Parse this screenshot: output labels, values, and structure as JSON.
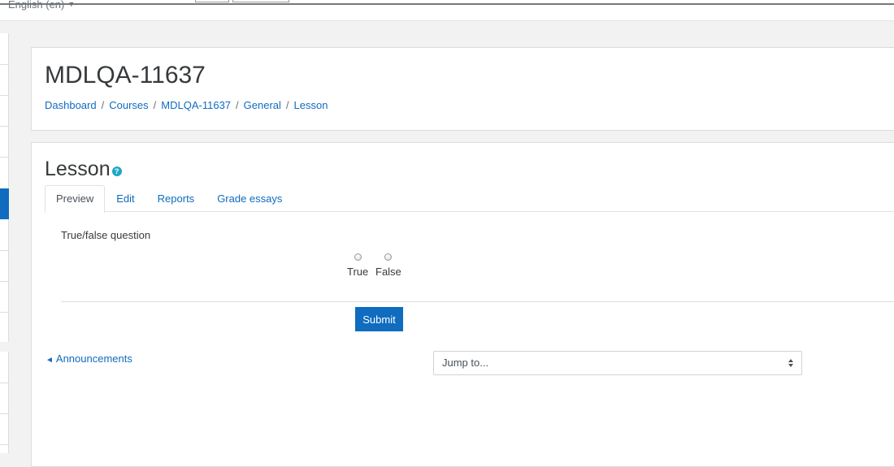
{
  "topbar": {
    "language": "English (en)"
  },
  "header": {
    "title": "MDLQA-11637",
    "breadcrumb": [
      {
        "label": "Dashboard"
      },
      {
        "label": "Courses"
      },
      {
        "label": "MDLQA-11637"
      },
      {
        "label": "General"
      },
      {
        "label": "Lesson"
      }
    ],
    "breadcrumb_separator": "/"
  },
  "activity": {
    "title": "Lesson",
    "help_icon": "question-circle-icon",
    "help_glyph": "?"
  },
  "tabs": [
    {
      "label": "Preview",
      "active": true
    },
    {
      "label": "Edit",
      "active": false
    },
    {
      "label": "Reports",
      "active": false
    },
    {
      "label": "Grade essays",
      "active": false
    }
  ],
  "question": {
    "label": "True/false question",
    "options": [
      {
        "label": "True",
        "selected": false
      },
      {
        "label": "False",
        "selected": false
      }
    ],
    "submit_label": "Submit"
  },
  "navigation": {
    "prev_arrow": "◄",
    "prev_label": "Announcements",
    "jump_label": "Jump to..."
  },
  "colors": {
    "accent": "#0f6cbf",
    "info": "#1ea7c5"
  }
}
